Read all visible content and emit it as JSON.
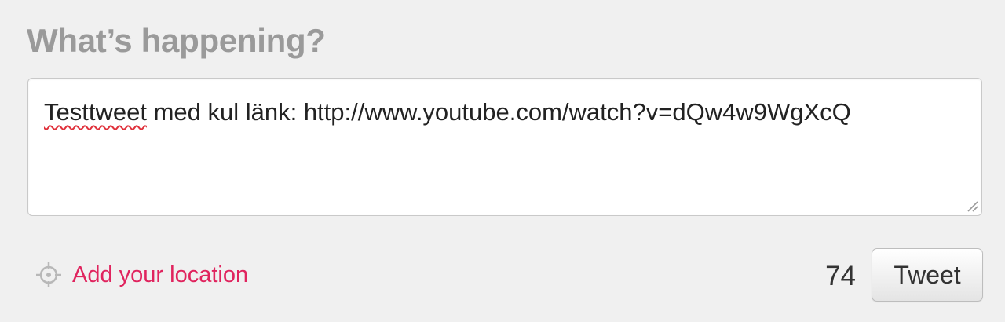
{
  "composer": {
    "heading": "What’s happening?",
    "text_misspelled": "Testtweet",
    "text_rest": " med kul länk: http://www.youtube.com/watch?v=dQw4w9WgXcQ"
  },
  "footer": {
    "location_label": "Add your location",
    "location_icon": "crosshair-icon",
    "char_counter": "74",
    "tweet_label": "Tweet"
  },
  "colors": {
    "background": "#f0f0f0",
    "heading": "#9a9a9a",
    "location_link": "#e0245e",
    "spellcheck_underline": "#e0323c"
  }
}
